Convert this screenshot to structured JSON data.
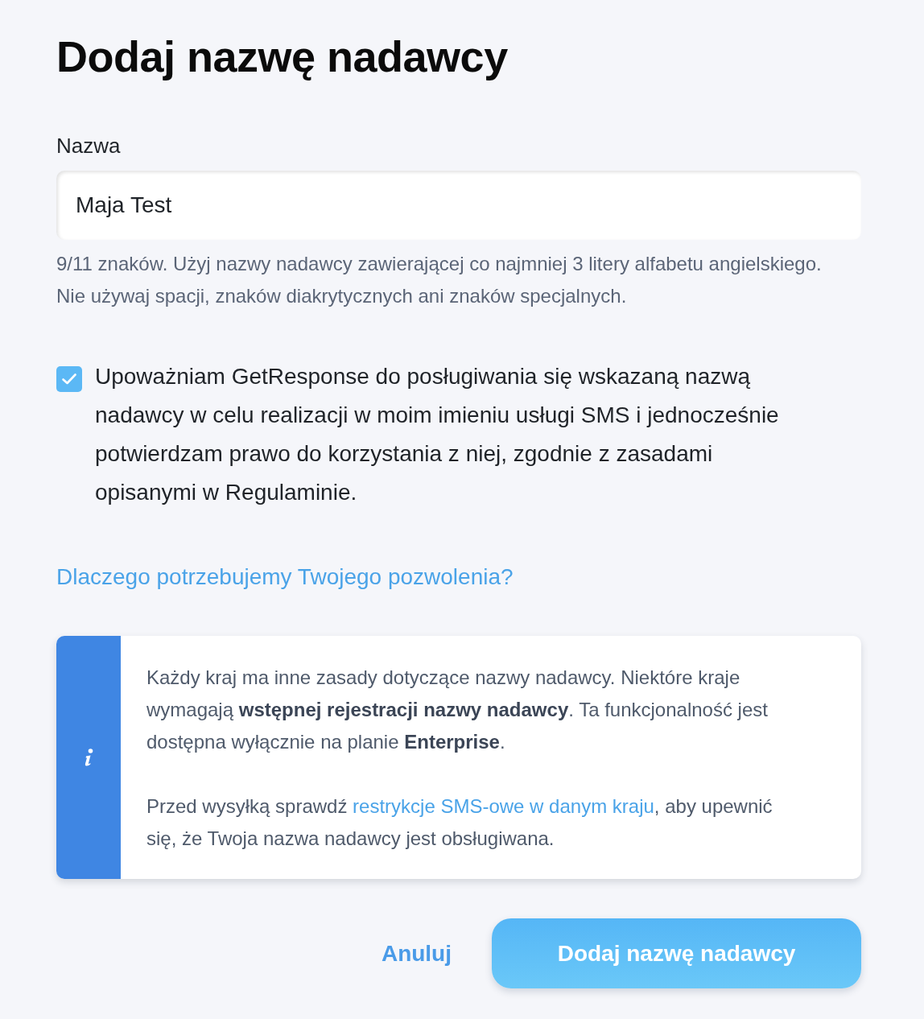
{
  "title": "Dodaj nazwę nadawcy",
  "name_field": {
    "label": "Nazwa",
    "value": "Maja Test",
    "hint": "9/11 znaków. Użyj nazwy nadawcy zawierającej co najmniej 3 litery alfabetu angielskiego. Nie używaj spacji, znaków diakrytycznych ani znaków specjalnych."
  },
  "consent": {
    "checked": true,
    "text": "Upoważniam GetResponse do posługiwania się wskazaną nazwą nadawcy w celu realizacji w moim imieniu usługi SMS i jednocześnie potwierdzam prawo do korzystania z niej, zgodnie z zasadami opisanymi w Regulaminie."
  },
  "help_link": "Dlaczego potrzebujemy Twojego pozwolenia?",
  "info": {
    "paragraphs": [
      {
        "kind": "text",
        "text": "Każdy kraj ma inne zasady dotyczące nazwy nadawcy. Niektóre kraje wymagają **wstępnej rejestracji nazwy nadawcy**. Ta funkcjonalność jest dostępna wyłącznie na planie **Enterprise**."
      },
      {
        "kind": "link",
        "before": "Przed wysyłką sprawdź",
        "link": "restrykcje SMS-owe w danym kraju",
        "after": ", aby upewnić się, że Twoja nazwa nadawcy jest obsługiwana."
      }
    ]
  },
  "buttons": [
    {
      "kind": "link",
      "label": "Anuluj"
    },
    {
      "kind": "primary",
      "label": "Dodaj nazwę nadawcy"
    }
  ]
}
